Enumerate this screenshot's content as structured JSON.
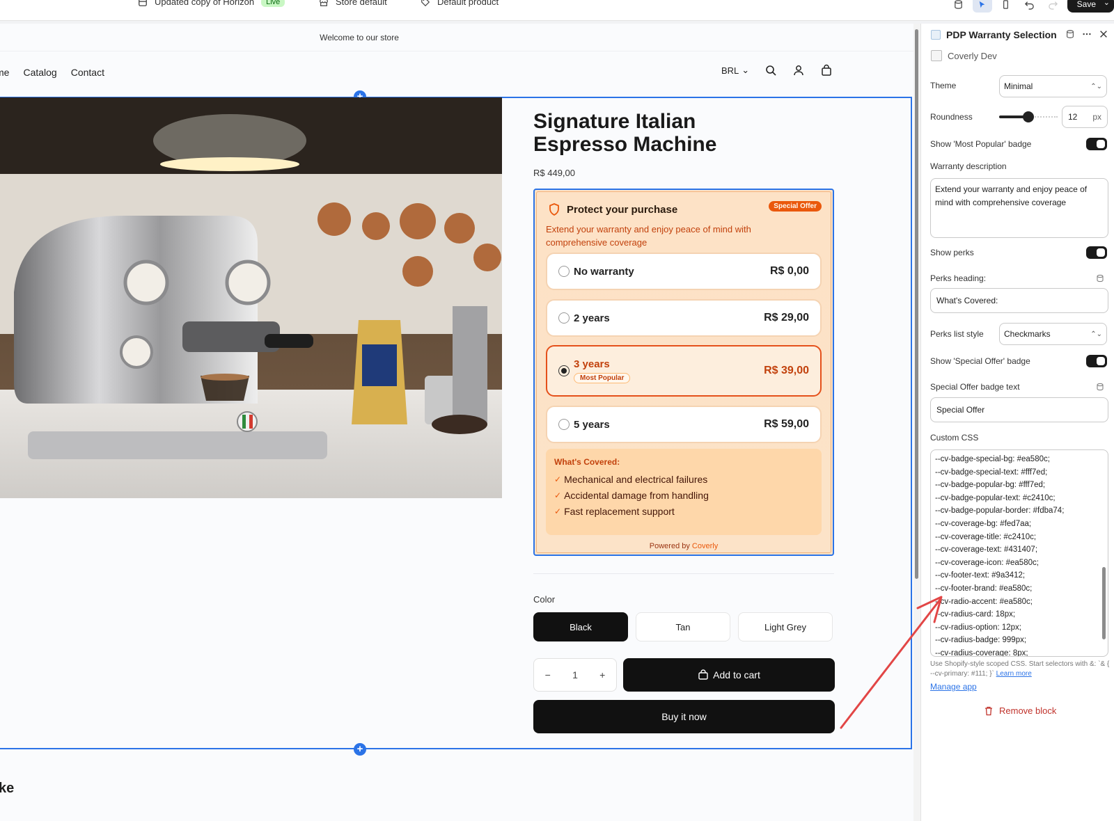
{
  "topbar": {
    "theme_name": "Updated copy of Horizon",
    "theme_status": "Live",
    "context": "Store default",
    "template": "Default product",
    "save_label": "Save"
  },
  "store": {
    "announcement": "Welcome to our store",
    "nav": [
      "me",
      "Catalog",
      "Contact"
    ],
    "currency": "BRL",
    "trailing_heading": "ke"
  },
  "product": {
    "title": "Signature Italian Espresso Machine",
    "price": "R$ 449,00",
    "color_label": "Color",
    "colors": [
      "Black",
      "Tan",
      "Light Grey"
    ],
    "selected_color": "Black",
    "quantity": "1",
    "qty_minus": "−",
    "qty_plus": "+",
    "add_to_cart": "Add to cart",
    "buy_now": "Buy it now"
  },
  "warranty": {
    "heading": "Protect your purchase",
    "badge": "Special Offer",
    "description": "Extend your warranty and enjoy peace of mind with comprehensive coverage",
    "options": [
      {
        "label": "No warranty",
        "price": "R$ 0,00"
      },
      {
        "label": "2 years",
        "price": "R$ 29,00"
      },
      {
        "label": "3 years",
        "price": "R$ 39,00",
        "badge": "Most Popular"
      },
      {
        "label": "5 years",
        "price": "R$ 59,00"
      }
    ],
    "selected_index": 2,
    "coverage_title": "What's Covered:",
    "coverage_items": [
      "Mechanical and electrical failures",
      "Accidental damage from handling",
      "Fast replacement support"
    ],
    "footer_prefix": "Powered by",
    "footer_brand": "Coverly"
  },
  "panel": {
    "title": "PDP Warranty Selection",
    "app_name": "Coverly Dev",
    "theme_label": "Theme",
    "theme_value": "Minimal",
    "roundness_label": "Roundness",
    "roundness_value": "12",
    "roundness_unit": "px",
    "roundness_fraction": 0.5,
    "show_popular_label": "Show 'Most Popular' badge",
    "warranty_desc_label": "Warranty description",
    "warranty_desc_value": "Extend your warranty and enjoy peace of mind with comprehensive coverage",
    "show_perks_label": "Show perks",
    "perks_heading_label": "Perks heading:",
    "perks_heading_value": "What's Covered:",
    "perks_style_label": "Perks list style",
    "perks_style_value": "Checkmarks",
    "show_special_label": "Show 'Special Offer' badge",
    "special_text_label": "Special Offer badge text",
    "special_text_value": "Special Offer",
    "custom_css_label": "Custom CSS",
    "custom_css_lines": [
      "--cv-badge-special-bg: #ea580c;",
      "--cv-badge-special-text: #fff7ed;",
      "--cv-badge-popular-bg: #fff7ed;",
      "--cv-badge-popular-text: #c2410c;",
      "--cv-badge-popular-border: #fdba74;",
      "--cv-coverage-bg: #fed7aa;",
      "--cv-coverage-title: #c2410c;",
      "--cv-coverage-text: #431407;",
      "--cv-coverage-icon: #ea580c;",
      "--cv-footer-text: #9a3412;",
      "--cv-footer-brand: #ea580c;",
      "--cv-radio-accent: #ea580c;",
      "--cv-radius-card: 18px;",
      "--cv-radius-option: 12px;",
      "--cv-radius-badge: 999px;",
      "--cv-radius-coverage: 8px;"
    ],
    "css_help": "Use Shopify-style scoped CSS. Start selectors with &: `& { --cv-primary: #111; }`",
    "learn_more": "Learn more",
    "manage_app": "Manage app",
    "remove_block": "Remove block"
  },
  "colors": {
    "accent": "#ea580c",
    "selection": "#2b73e7",
    "danger": "#c0322b"
  }
}
